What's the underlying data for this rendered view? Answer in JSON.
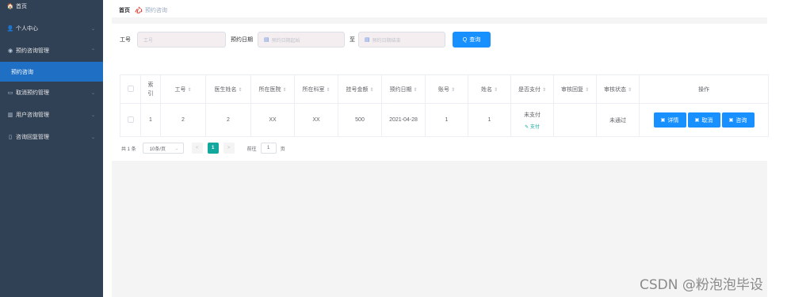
{
  "sidebar": {
    "items": [
      {
        "label": "首页",
        "icon": "home-icon",
        "glyph": "🏠"
      },
      {
        "label": "个人中心",
        "icon": "user-icon",
        "glyph": "👤",
        "arrow": "⌄"
      },
      {
        "label": "预约咨询管理",
        "icon": "appointment-icon",
        "glyph": "◉",
        "arrow": "⌃"
      },
      {
        "label": "预约咨询",
        "active": true
      },
      {
        "label": "取消预约管理",
        "icon": "cancel-icon",
        "glyph": "▭",
        "arrow": "⌄"
      },
      {
        "label": "用户咨询管理",
        "icon": "chart-icon",
        "glyph": "▥",
        "arrow": "⌄"
      },
      {
        "label": "咨询回复管理",
        "icon": "mobile-icon",
        "glyph": "▯",
        "arrow": "⌄"
      }
    ]
  },
  "breadcrumb": {
    "home": "首页",
    "logo_glyph": "心",
    "current": "预约咨询"
  },
  "search": {
    "job_label": "工号",
    "job_placeholder": "工号",
    "date_label": "预约日期",
    "date_start_placeholder": "预约日期起始",
    "date_sep": "至",
    "date_end_placeholder": "预约日期结束",
    "query_button": "查询",
    "search_glyph": "Q",
    "calendar_glyph": "▤"
  },
  "table": {
    "columns": [
      "索引",
      "工号",
      "医生姓名",
      "所在医院",
      "所在科室",
      "挂号金额",
      "预约日期",
      "账号",
      "姓名",
      "是否支付",
      "审核回复",
      "审核状态",
      "操作"
    ],
    "sort_glyph": "⇕",
    "rows": [
      {
        "index": "1",
        "job_no": "2",
        "doctor_name": "2",
        "hospital": "XX",
        "department": "XX",
        "fee": "500",
        "date": "2021-04-28",
        "account": "1",
        "name": "1",
        "paid": "未支付",
        "pay_link": "支付",
        "review_reply": "",
        "review_status": "未通过"
      }
    ],
    "actions": {
      "detail": "详情",
      "cancel": "取消",
      "consult": "咨询",
      "action_glyph": "▣"
    }
  },
  "pagination": {
    "total": "共 1 条",
    "page_size": "10条/页",
    "prev": "<",
    "current_page": "1",
    "next": ">",
    "goto_label": "前往",
    "goto_value": "1",
    "page_suffix": "页"
  },
  "watermark": "CSDN @粉泡泡毕设",
  "colors": {
    "sidebar_bg": "#304156",
    "active_menu": "#1f70c4",
    "primary": "#1890ff",
    "pager_active": "#13a89e"
  }
}
